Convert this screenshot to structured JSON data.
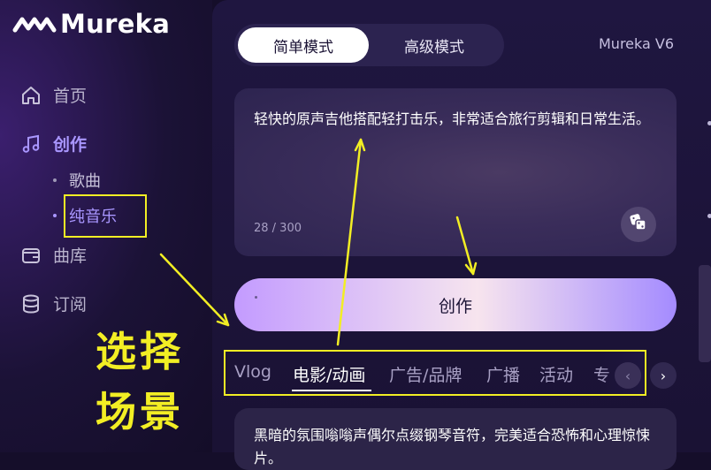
{
  "app": {
    "name": "Mureka",
    "version": "Mureka V6"
  },
  "sidebar": {
    "items": [
      {
        "label": "首页",
        "icon": "home-icon"
      },
      {
        "label": "创作",
        "icon": "music-note-icon"
      },
      {
        "label": "曲库",
        "icon": "wallet-icon"
      },
      {
        "label": "订阅",
        "icon": "database-icon"
      }
    ],
    "subitems": [
      {
        "label": "歌曲"
      },
      {
        "label": "纯音乐"
      }
    ]
  },
  "mode_toggle": {
    "simple": "简单模式",
    "advanced": "高级模式"
  },
  "prompt": {
    "text": "轻快的原声吉他搭配轻打击乐，非常适合旅行剪辑和日常生活。",
    "count": "28 / 300"
  },
  "create_button": "创作",
  "scene_tabs": [
    {
      "label": "Vlog"
    },
    {
      "label": "电影/动画"
    },
    {
      "label": "广告/品牌"
    },
    {
      "label": "广播"
    },
    {
      "label": "活动"
    },
    {
      "label": "专"
    }
  ],
  "preset": {
    "text": "黑暗的氛围嗡嗡声偶尔点缀钢琴音符，完美适合恐怖和心理惊悚片。"
  },
  "annotation": {
    "line1": "选择",
    "line2": "场景",
    "color": "#f2ee24"
  },
  "colors": {
    "accent": "#a996ff",
    "background": "#150e2a"
  }
}
